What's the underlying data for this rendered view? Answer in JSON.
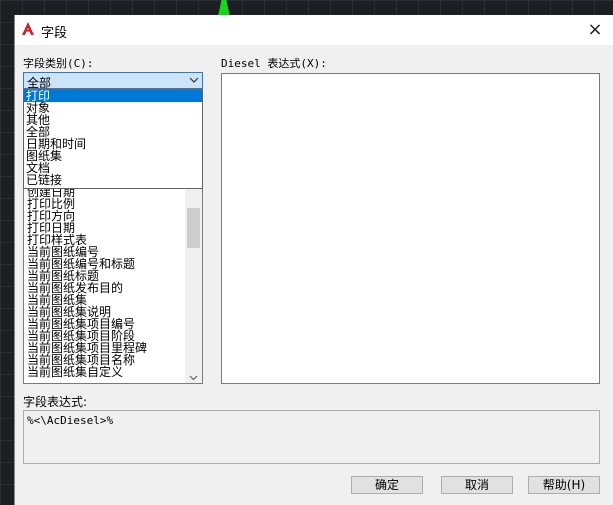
{
  "dialog": {
    "title": "字段",
    "close_icon": "×"
  },
  "category": {
    "label": "字段类别(C):",
    "selected": "全部",
    "options": [
      "打印",
      "对象",
      "其他",
      "全部",
      "日期和时间",
      "图纸集",
      "文档",
      "已链接"
    ],
    "highlighted_index": 0
  },
  "field_names": {
    "items": [
      "打印",
      "对象",
      "其他",
      "全部",
      "日期和时间",
      "图纸集",
      "文档",
      "已链接",
      "创建日期",
      "打印比例",
      "打印方向",
      "打印日期",
      "打印样式表",
      "当前图纸编号",
      "当前图纸编号和标题",
      "当前图纸标题",
      "当前图纸发布目的",
      "当前图纸集",
      "当前图纸集说明",
      "当前图纸集项目编号",
      "当前图纸集项目阶段",
      "当前图纸集项目里程碑",
      "当前图纸集项目名称",
      "当前图纸集自定义"
    ]
  },
  "diesel": {
    "label": "Diesel 表达式(X):",
    "value": ""
  },
  "expression": {
    "label": "字段表达式:",
    "value": "%<\\AcDiesel>%"
  },
  "buttons": {
    "ok": "确定",
    "cancel": "取消",
    "help": "帮助(H)"
  },
  "colors": {
    "selection": "#0078d7",
    "select_highlight": "#cce4f7",
    "dialog_bg": "#f0f0f0"
  }
}
